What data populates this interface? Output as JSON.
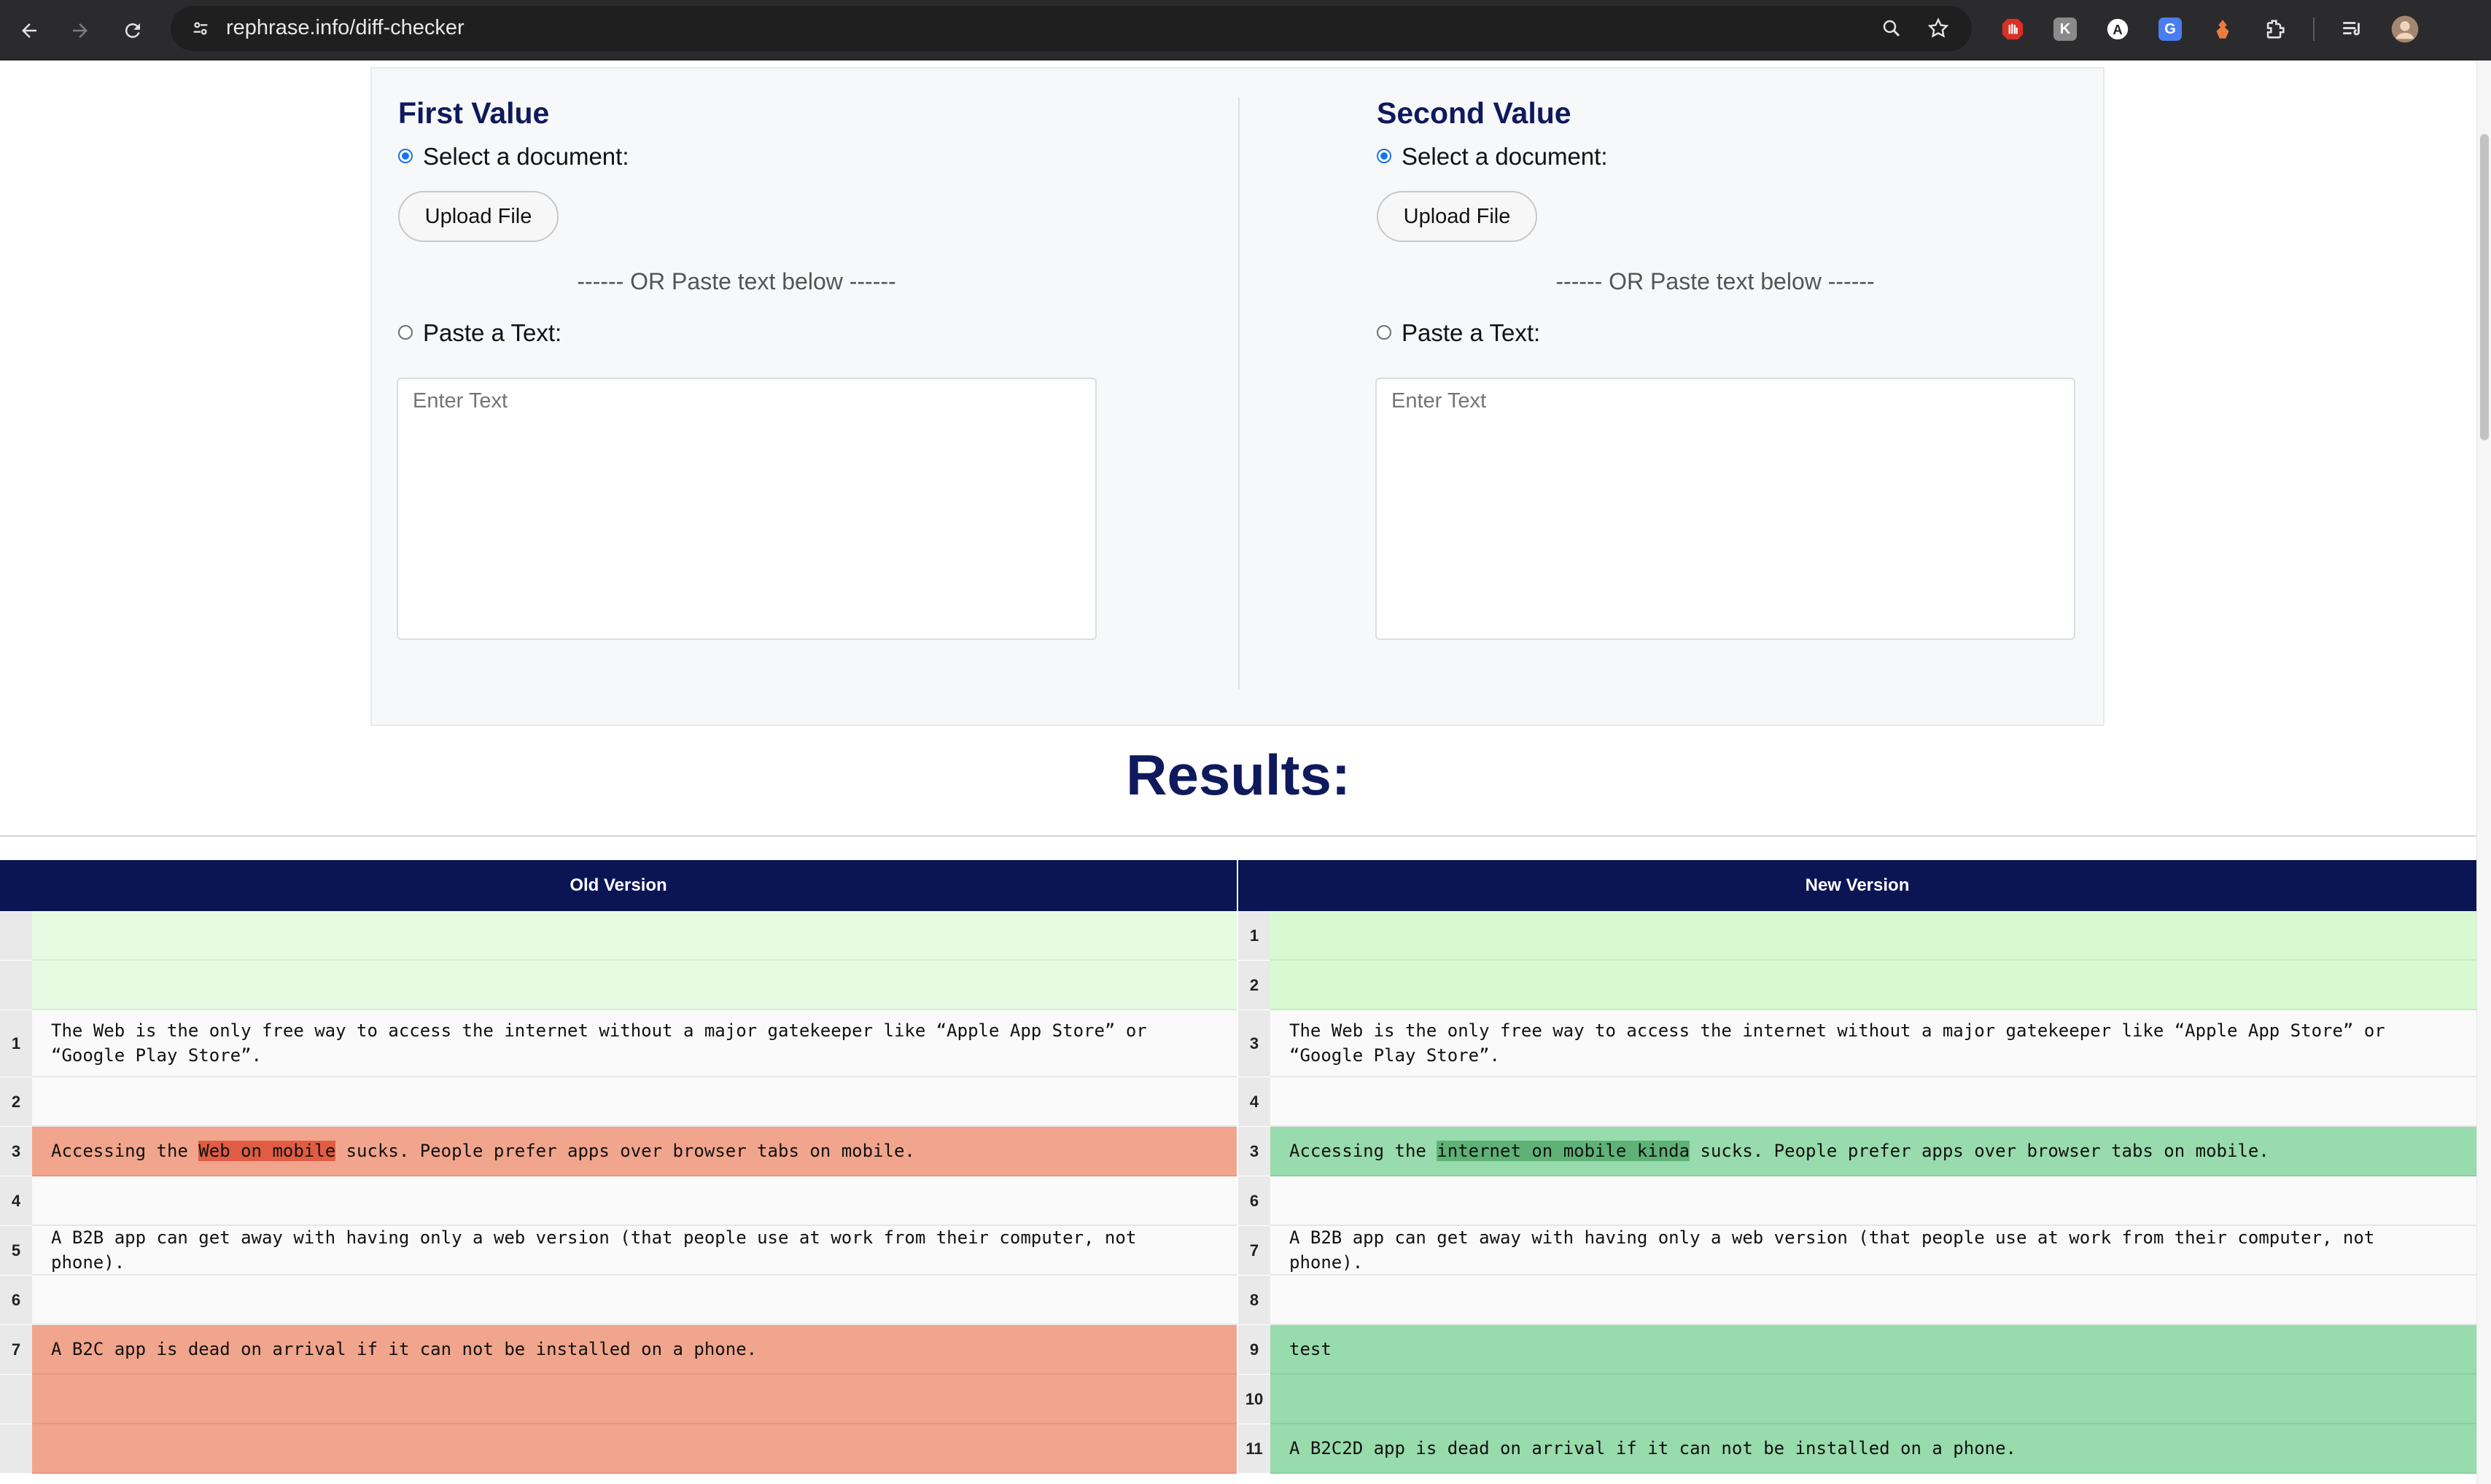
{
  "browser": {
    "url": "rephrase.info/diff-checker",
    "icons": [
      "back-icon",
      "forward-icon",
      "reload-icon",
      "site-info-icon",
      "zoom-icon",
      "bookmark-star-icon",
      "tab-search-icon",
      "avatar"
    ],
    "extensions": [
      {
        "name": "adblock-extension-icon",
        "color": "#d93025",
        "glyph": "✋"
      },
      {
        "name": "extension-k-icon",
        "color": "#8a8a8a",
        "glyph": "K"
      },
      {
        "name": "extension-a-icon",
        "color": "#3c3c3c",
        "glyph": "A"
      },
      {
        "name": "google-translate-icon",
        "color": "#4a7ef0",
        "glyph": "G"
      },
      {
        "name": "extension-orange-icon",
        "color": "#ef7b3a",
        "glyph": "♟"
      },
      {
        "name": "extensions-puzzle-icon",
        "color": "transparent",
        "glyph": ""
      }
    ]
  },
  "form": {
    "left": {
      "title": "First Value",
      "select_label": "Select a document:",
      "upload_label": "Upload File",
      "or_text": "------ OR Paste text below ------",
      "paste_label": "Paste a Text:",
      "placeholder": "Enter Text"
    },
    "right": {
      "title": "Second Value",
      "select_label": "Select a document:",
      "upload_label": "Upload File",
      "or_text": "------ OR Paste text below ------",
      "paste_label": "Paste a Text:",
      "placeholder": "Enter Text"
    }
  },
  "results": {
    "title": "Results:",
    "old_header": "Old Version",
    "new_header": "New Version",
    "rows": [
      {
        "lnum": "",
        "ltype": "ladd",
        "ltext": [],
        "rnum": "1",
        "rtype": "radd",
        "rtext": [],
        "tall": false
      },
      {
        "lnum": "",
        "ltype": "ladd",
        "ltext": [],
        "rnum": "2",
        "rtype": "radd",
        "rtext": [],
        "tall": false
      },
      {
        "lnum": "1",
        "ltype": "plain",
        "ltext": [
          {
            "t": "The Web is the only free way to access the internet without a major gatekeeper like “Apple App Store” or “Google Play Store”."
          }
        ],
        "rnum": "3",
        "rtype": "plain",
        "rtext": [
          {
            "t": "The Web is the only free way to access the internet without a major gatekeeper like “Apple App Store” or “Google Play Store”."
          }
        ],
        "tall": true
      },
      {
        "lnum": "2",
        "ltype": "plain",
        "ltext": [],
        "rnum": "4",
        "rtype": "plain",
        "rtext": [],
        "tall": false
      },
      {
        "lnum": "3",
        "ltype": "del",
        "ltext": [
          {
            "t": "Accessing the "
          },
          {
            "t": "Web on mobile",
            "hl": "del"
          },
          {
            "t": " sucks. People prefer apps over browser tabs on mobile."
          }
        ],
        "rnum": "3",
        "rtype": "ins",
        "rtext": [
          {
            "t": "Accessing the "
          },
          {
            "t": "internet on mobile kinda",
            "hl": "ins"
          },
          {
            "t": " sucks. People prefer apps over browser tabs on mobile."
          }
        ],
        "tall": false
      },
      {
        "lnum": "4",
        "ltype": "plain",
        "ltext": [],
        "rnum": "6",
        "rtype": "plain",
        "rtext": [],
        "tall": false
      },
      {
        "lnum": "5",
        "ltype": "plain",
        "ltext": [
          {
            "t": "A B2B app can get away with having only a web version (that people use at work from their computer, not phone)."
          }
        ],
        "rnum": "7",
        "rtype": "plain",
        "rtext": [
          {
            "t": "A B2B app can get away with having only a web version (that people use at work from their computer, not phone)."
          }
        ],
        "tall": false
      },
      {
        "lnum": "6",
        "ltype": "plain",
        "ltext": [],
        "rnum": "8",
        "rtype": "plain",
        "rtext": [],
        "tall": false
      },
      {
        "lnum": "7",
        "ltype": "del",
        "ltext": [
          {
            "t": "A B2C app is dead on arrival if it can not be installed on a phone."
          }
        ],
        "rnum": "9",
        "rtype": "ins",
        "rtext": [
          {
            "t": "test"
          }
        ],
        "tall": false
      },
      {
        "lnum": "",
        "ltype": "del",
        "ltext": [],
        "rnum": "10",
        "rtype": "ins",
        "rtext": [],
        "tall": false
      },
      {
        "lnum": "",
        "ltype": "del",
        "ltext": [],
        "rnum": "11",
        "rtype": "ins",
        "rtext": [
          {
            "t": "A B2C2D app is dead on arrival if it can not be installed on a phone."
          }
        ],
        "tall": false
      }
    ]
  }
}
